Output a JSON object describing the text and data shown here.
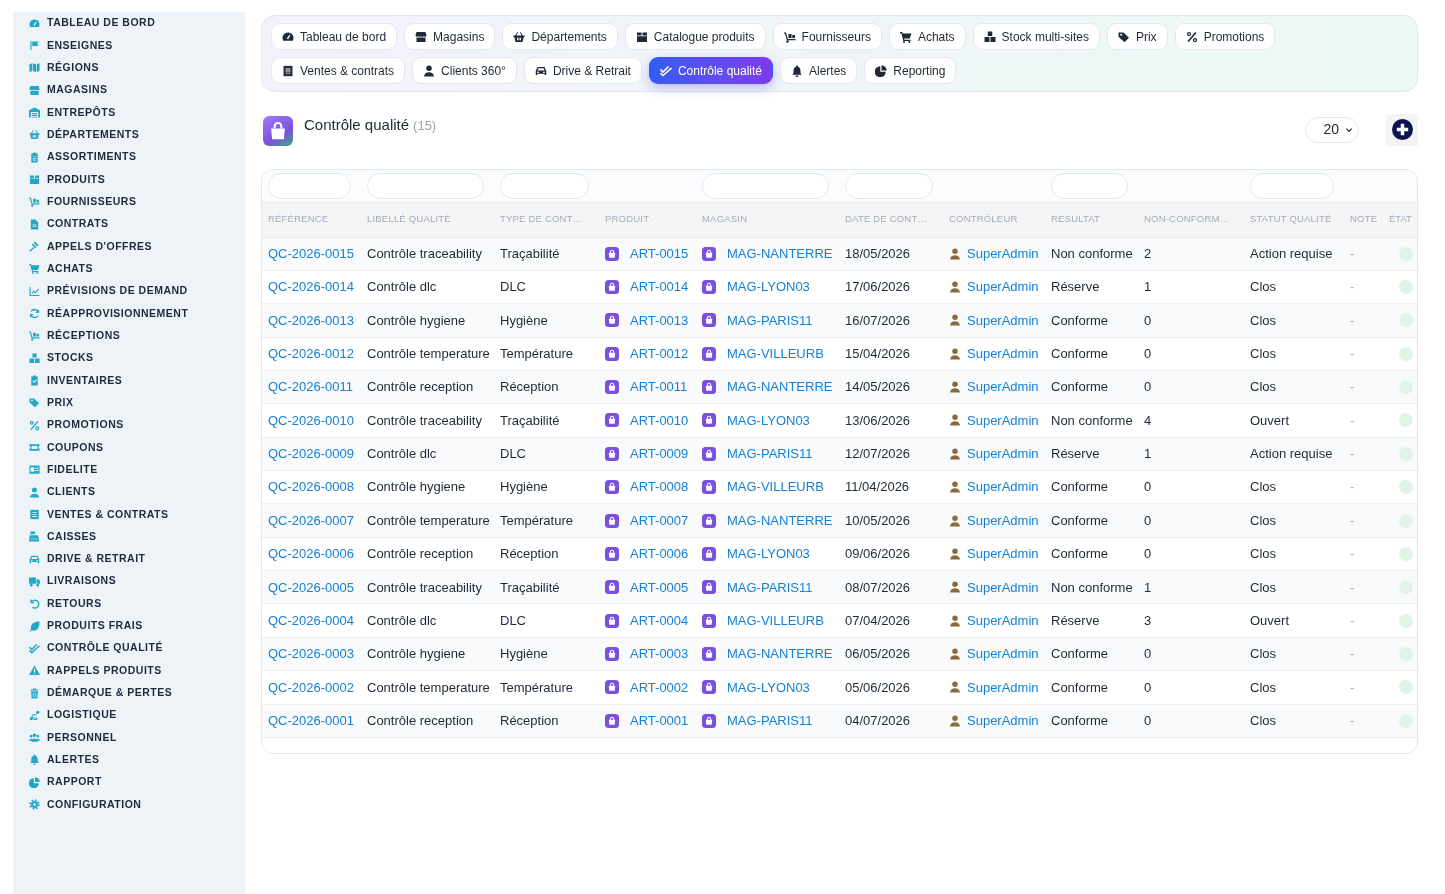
{
  "sidebar": {
    "items": [
      "TABLEAU DE BORD",
      "ENSEIGNES",
      "RÉGIONS",
      "MAGASINS",
      "ENTREPÔTS",
      "DÉPARTEMENTS",
      "ASSORTIMENTS",
      "PRODUITS",
      "FOURNISSEURS",
      "CONTRATS",
      "APPELS D'OFFRES",
      "ACHATS",
      "PRÉVISIONS DE DEMAND",
      "RÉAPPROVISIONNEMENT",
      "RÉCEPTIONS",
      "STOCKS",
      "INVENTAIRES",
      "PRIX",
      "PROMOTIONS",
      "COUPONS",
      "FIDELITE",
      "CLIENTS",
      "VENTES & CONTRATS",
      "CAISSES",
      "DRIVE & RETRAIT",
      "LIVRAISONS",
      "RETOURS",
      "PRODUITS FRAIS",
      "CONTRÔLE QUALITÉ",
      "RAPPELS PRODUITS",
      "DÉMARQUE & PERTES",
      "LOGISTIQUE",
      "PERSONNEL",
      "ALERTES",
      "RAPPORT",
      "CONFIGURATION"
    ]
  },
  "tabs": [
    {
      "label": "Tableau de bord",
      "selected": false
    },
    {
      "label": "Magasins",
      "selected": false
    },
    {
      "label": "Départements",
      "selected": false
    },
    {
      "label": "Catalogue produits",
      "selected": false
    },
    {
      "label": "Fournisseurs",
      "selected": false
    },
    {
      "label": "Achats",
      "selected": false
    },
    {
      "label": "Stock multi-sites",
      "selected": false
    },
    {
      "label": "Prix",
      "selected": false
    },
    {
      "label": "Promotions",
      "selected": false
    },
    {
      "label": "Ventes & contrats",
      "selected": false
    },
    {
      "label": "Clients 360°",
      "selected": false
    },
    {
      "label": "Drive & Retrait",
      "selected": false
    },
    {
      "label": "Contrôle qualité",
      "selected": true
    },
    {
      "label": "Alertes",
      "selected": false
    },
    {
      "label": "Reporting",
      "selected": false
    }
  ],
  "page_header": {
    "title": "Contrôle qualité",
    "count": "(15)",
    "page_size": "20"
  },
  "table": {
    "columns": [
      {
        "label": "RÉFÉRENCE",
        "filter": true
      },
      {
        "label": "LIBELLÉ QUALITÉ",
        "filter": true
      },
      {
        "label": "TYPE DE CONT…",
        "filter": true
      },
      {
        "label": "PRODUIT",
        "filter": false
      },
      {
        "label": "MAGASIN",
        "filter": true
      },
      {
        "label": "DATE DE CONT…",
        "filter": true
      },
      {
        "label": "CONTRÔLEUR",
        "filter": false
      },
      {
        "label": "RESULTAT",
        "filter": true
      },
      {
        "label": "NON-CONFORM…",
        "filter": false
      },
      {
        "label": "STATUT QUALITÉ",
        "filter": true
      },
      {
        "label": "NOTE",
        "filter": false
      },
      {
        "label": "ÉTAT",
        "filter": false
      }
    ],
    "rows": [
      {
        "reference": "QC-2026-0015",
        "label": "Contrôle traceability",
        "type": "Traçabilité",
        "product": "ART-0015",
        "store": "MAG-NANTERRE",
        "date": "18/05/2026",
        "controller": "SuperAdmin",
        "result": "Non conforme",
        "non_conformities": "2",
        "status": "Action requise",
        "note": "-"
      },
      {
        "reference": "QC-2026-0014",
        "label": "Contrôle dlc",
        "type": "DLC",
        "product": "ART-0014",
        "store": "MAG-LYON03",
        "date": "17/06/2026",
        "controller": "SuperAdmin",
        "result": "Réserve",
        "non_conformities": "1",
        "status": "Clos",
        "note": "-"
      },
      {
        "reference": "QC-2026-0013",
        "label": "Contrôle hygiene",
        "type": "Hygiène",
        "product": "ART-0013",
        "store": "MAG-PARIS11",
        "date": "16/07/2026",
        "controller": "SuperAdmin",
        "result": "Conforme",
        "non_conformities": "0",
        "status": "Clos",
        "note": "-"
      },
      {
        "reference": "QC-2026-0012",
        "label": "Contrôle temperature",
        "type": "Température",
        "product": "ART-0012",
        "store": "MAG-VILLEURB",
        "date": "15/04/2026",
        "controller": "SuperAdmin",
        "result": "Conforme",
        "non_conformities": "0",
        "status": "Clos",
        "note": "-"
      },
      {
        "reference": "QC-2026-0011",
        "label": "Contrôle reception",
        "type": "Réception",
        "product": "ART-0011",
        "store": "MAG-NANTERRE",
        "date": "14/05/2026",
        "controller": "SuperAdmin",
        "result": "Conforme",
        "non_conformities": "0",
        "status": "Clos",
        "note": "-"
      },
      {
        "reference": "QC-2026-0010",
        "label": "Contrôle traceability",
        "type": "Traçabilité",
        "product": "ART-0010",
        "store": "MAG-LYON03",
        "date": "13/06/2026",
        "controller": "SuperAdmin",
        "result": "Non conforme",
        "non_conformities": "4",
        "status": "Ouvert",
        "note": "-"
      },
      {
        "reference": "QC-2026-0009",
        "label": "Contrôle dlc",
        "type": "DLC",
        "product": "ART-0009",
        "store": "MAG-PARIS11",
        "date": "12/07/2026",
        "controller": "SuperAdmin",
        "result": "Réserve",
        "non_conformities": "1",
        "status": "Action requise",
        "note": "-"
      },
      {
        "reference": "QC-2026-0008",
        "label": "Contrôle hygiene",
        "type": "Hygiène",
        "product": "ART-0008",
        "store": "MAG-VILLEURB",
        "date": "11/04/2026",
        "controller": "SuperAdmin",
        "result": "Conforme",
        "non_conformities": "0",
        "status": "Clos",
        "note": "-"
      },
      {
        "reference": "QC-2026-0007",
        "label": "Contrôle temperature",
        "type": "Température",
        "product": "ART-0007",
        "store": "MAG-NANTERRE",
        "date": "10/05/2026",
        "controller": "SuperAdmin",
        "result": "Conforme",
        "non_conformities": "0",
        "status": "Clos",
        "note": "-"
      },
      {
        "reference": "QC-2026-0006",
        "label": "Contrôle reception",
        "type": "Réception",
        "product": "ART-0006",
        "store": "MAG-LYON03",
        "date": "09/06/2026",
        "controller": "SuperAdmin",
        "result": "Conforme",
        "non_conformities": "0",
        "status": "Clos",
        "note": "-"
      },
      {
        "reference": "QC-2026-0005",
        "label": "Contrôle traceability",
        "type": "Traçabilité",
        "product": "ART-0005",
        "store": "MAG-PARIS11",
        "date": "08/07/2026",
        "controller": "SuperAdmin",
        "result": "Non conforme",
        "non_conformities": "1",
        "status": "Clos",
        "note": "-"
      },
      {
        "reference": "QC-2026-0004",
        "label": "Contrôle dlc",
        "type": "DLC",
        "product": "ART-0004",
        "store": "MAG-VILLEURB",
        "date": "07/04/2026",
        "controller": "SuperAdmin",
        "result": "Réserve",
        "non_conformities": "3",
        "status": "Ouvert",
        "note": "-"
      },
      {
        "reference": "QC-2026-0003",
        "label": "Contrôle hygiene",
        "type": "Hygiène",
        "product": "ART-0003",
        "store": "MAG-NANTERRE",
        "date": "06/05/2026",
        "controller": "SuperAdmin",
        "result": "Conforme",
        "non_conformities": "0",
        "status": "Clos",
        "note": "-"
      },
      {
        "reference": "QC-2026-0002",
        "label": "Contrôle temperature",
        "type": "Température",
        "product": "ART-0002",
        "store": "MAG-LYON03",
        "date": "05/06/2026",
        "controller": "SuperAdmin",
        "result": "Conforme",
        "non_conformities": "0",
        "status": "Clos",
        "note": "-"
      },
      {
        "reference": "QC-2026-0001",
        "label": "Contrôle reception",
        "type": "Réception",
        "product": "ART-0001",
        "store": "MAG-PARIS11",
        "date": "04/07/2026",
        "controller": "SuperAdmin",
        "result": "Conforme",
        "non_conformities": "0",
        "status": "Clos",
        "note": "-"
      }
    ]
  }
}
